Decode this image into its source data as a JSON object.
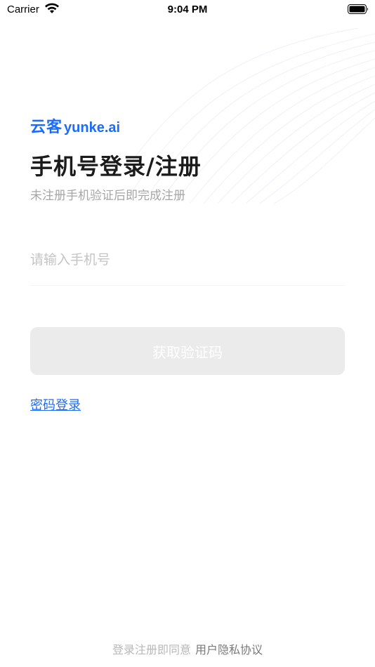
{
  "status_bar": {
    "carrier": "Carrier",
    "time": "9:04 PM",
    "icons": [
      "wifi-icon",
      "battery-icon"
    ]
  },
  "brand": {
    "logo_cn": "云客",
    "logo_en": "yunke.ai",
    "color": "#1a6cff"
  },
  "login": {
    "title": "手机号登录/注册",
    "subtitle": "未注册手机验证后即完成注册",
    "phone_placeholder": "请输入手机号",
    "phone_value": "",
    "get_code_label": "获取验证码",
    "password_login_label": "密码登录"
  },
  "footer": {
    "agreement_prefix": "登录注册即同意",
    "agreement_link": "用户隐私协议"
  },
  "colors": {
    "accent": "#1a6cff",
    "button_disabled_bg": "#ebebeb",
    "placeholder": "#c4c4c4",
    "subtitle": "#a6a6a6"
  }
}
